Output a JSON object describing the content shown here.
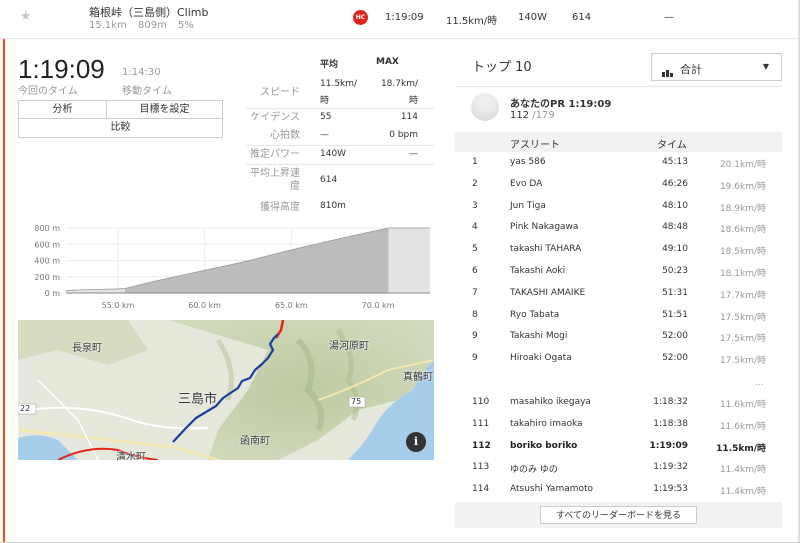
{
  "segment": {
    "name": "箱根峠（三島側）Climb",
    "distance": "15.1km",
    "elevation": "809m",
    "grade": "5%",
    "category_badge": "HC",
    "time": "1:19:09",
    "speed": "11.5km/時",
    "power": "140W",
    "vam": "614",
    "extra": "—"
  },
  "summary": {
    "elapsed_time": "1:19:09",
    "elapsed_label": "今回のタイム",
    "moving_time": "1:14:30",
    "moving_label": "移動タイム",
    "buttons": {
      "analysis": "分析",
      "set_goal": "目標を設定",
      "compare": "比較"
    }
  },
  "stats": {
    "headers": {
      "avg": "平均",
      "max": "MAX"
    },
    "rows": [
      {
        "label": "スピード",
        "avg": [
          "11.5km/",
          "時"
        ],
        "max": [
          "18.7km/",
          "時"
        ]
      },
      {
        "label": "ケイデンス",
        "avg": [
          "55"
        ],
        "max": [
          "114"
        ]
      },
      {
        "label": "心拍数",
        "avg": [
          "—"
        ],
        "max": [
          "0 bpm"
        ]
      },
      {
        "label": "推定パワー",
        "avg": [
          "140W"
        ],
        "max": [
          "—"
        ]
      },
      {
        "label": [
          "平均上昇速",
          "度"
        ],
        "avg": [
          "614"
        ],
        "max": []
      },
      {
        "label": "獲得高度",
        "avg": [
          "810m"
        ],
        "max": []
      }
    ]
  },
  "chart_data": {
    "type": "area",
    "x_range": [
      52,
      73
    ],
    "ylim": [
      0,
      800
    ],
    "xticks": [
      "55.0 km",
      "60.0 km",
      "65.0 km",
      "70.0 km"
    ],
    "xtick_values": [
      55,
      60,
      65,
      70
    ],
    "yticks": [
      "800 m",
      "600 m",
      "400 m",
      "200 m",
      "0 m"
    ],
    "ytick_values": [
      800,
      600,
      400,
      200,
      0
    ],
    "highlight_range": [
      55.4,
      70.6
    ],
    "profile": [
      [
        52,
        30
      ],
      [
        53,
        40
      ],
      [
        54,
        45
      ],
      [
        55,
        50
      ],
      [
        55.4,
        55
      ],
      [
        57,
        140
      ],
      [
        60,
        280
      ],
      [
        62,
        370
      ],
      [
        65,
        530
      ],
      [
        68,
        680
      ],
      [
        70.6,
        830
      ],
      [
        71.5,
        830
      ],
      [
        73,
        830
      ]
    ],
    "grid": true
  },
  "map": {
    "labels": {
      "nagaizumi": "長泉町",
      "yugawara": "湯河原町",
      "mishima": "三島市",
      "manazuru": "真鶴町",
      "kannami": "函南町",
      "shimizu": "清水町",
      "route22": "22",
      "route75": "75"
    },
    "info_icon": "info-icon",
    "colors": {
      "route": "#1b3f9a",
      "road_red": "#e2231a",
      "water": "#a6cdea"
    }
  },
  "leaderboard": {
    "title": "トップ 10",
    "filter": "合計",
    "pr_title": "あなたのPR 1:19:09",
    "pr_rank": "112",
    "pr_total": "/179",
    "headers": {
      "athlete": "アスリート",
      "time": "タイム"
    },
    "top": [
      {
        "rank": "1",
        "name": "yas 586",
        "time": "45:13",
        "speed": "20.1km/時"
      },
      {
        "rank": "2",
        "name": "Evo DA",
        "time": "46:26",
        "speed": "19.6km/時"
      },
      {
        "rank": "3",
        "name": "Jun Tiga",
        "time": "48:10",
        "speed": "18.9km/時"
      },
      {
        "rank": "4",
        "name": "Pink Nakagawa",
        "time": "48:48",
        "speed": "18.6km/時"
      },
      {
        "rank": "5",
        "name": "takashi TAHARA",
        "time": "49:10",
        "speed": "18.5km/時"
      },
      {
        "rank": "6",
        "name": "Takashi Aoki",
        "time": "50:23",
        "speed": "18.1km/時"
      },
      {
        "rank": "7",
        "name": "TAKASHI AMAIKE",
        "time": "51:31",
        "speed": "17.7km/時"
      },
      {
        "rank": "8",
        "name": "Ryo Tabata",
        "time": "51:51",
        "speed": "17.5km/時"
      },
      {
        "rank": "9",
        "name": "Takashi Mogi",
        "time": "52:00",
        "speed": "17.5km/時"
      },
      {
        "rank": "9",
        "name": "Hiroaki Ogata",
        "time": "52:00",
        "speed": "17.5km/時"
      }
    ],
    "ellipsis": "...",
    "nearby": [
      {
        "rank": "110",
        "name": "masahiko ikegaya",
        "time": "1:18:32",
        "speed": "11.6km/時"
      },
      {
        "rank": "111",
        "name": "takahiro imaoka",
        "time": "1:18:38",
        "speed": "11.6km/時"
      },
      {
        "rank": "112",
        "name": "boriko boriko",
        "time": "1:19:09",
        "speed": "11.5km/時",
        "me": true
      },
      {
        "rank": "113",
        "name": "ゆのみ ゆの",
        "time": "1:19:32",
        "speed": "11.4km/時"
      },
      {
        "rank": "114",
        "name": "Atsushi Yamamoto",
        "time": "1:19:53",
        "speed": "11.4km/時"
      }
    ],
    "view_all": "すべてのリーダーボードを見る"
  }
}
